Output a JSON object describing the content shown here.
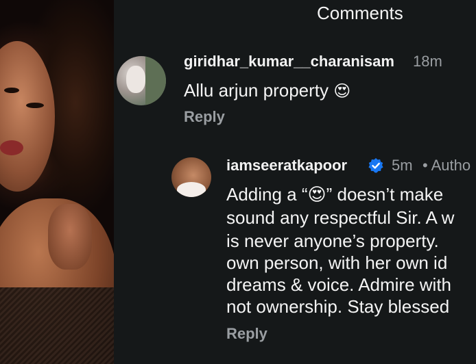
{
  "header": {
    "title": "Comments"
  },
  "comments": [
    {
      "username": "giridhar_kumar__charanisam",
      "time": "18m",
      "text": "Allu arjun property ",
      "emoji": "😍",
      "reply_label": "Reply",
      "avatar_icon": "user-avatar"
    }
  ],
  "reply": {
    "username": "iamseeratkapoor",
    "verified_icon": "verified-badge-icon",
    "verified_color": "#1877f2",
    "time": "5m",
    "author_tag": "• Autho",
    "lines": [
      "Adding a “😍” doesn’t make",
      "sound any respectful Sir. A w",
      "is never anyone’s property.",
      "own person, with her own id",
      "dreams & voice. Admire with",
      "not ownership. Stay blessed"
    ],
    "reply_label": "Reply"
  },
  "colors": {
    "background": "#151819",
    "muted": "#9a9ea2",
    "text": "#f2f2f2"
  }
}
